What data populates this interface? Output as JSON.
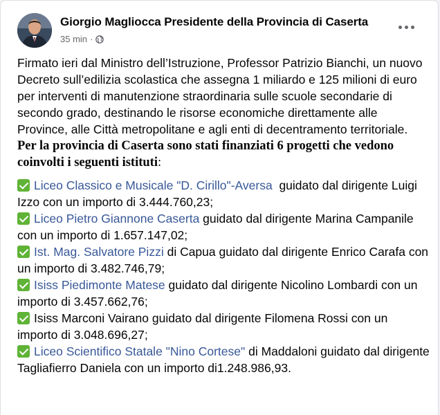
{
  "post": {
    "author": "Giorgio Magliocca Presidente della Provincia di Caserta",
    "time": "35 min",
    "separator": "·",
    "privacy_icon": "globe-icon",
    "more_icon": "more-options-icon",
    "intro": "Firmato ieri dal Ministro dell’Istruzione, Professor Patrizio Bianchi, un nuovo Decreto sull’edilizia scolastica che assegna 1 miliardo e 125 milioni di euro per interventi di manutenzione straordinaria sulle scuole secondarie di secondo grado, destinando le risorse economiche direttamente alle Province, alle Città metropolitane e agli enti di decentramento territoriale.",
    "bold_title": "Per la provincia di Caserta sono stati finanziati 6 progetti che vedono coinvolti i seguenti istituti",
    "bold_title_suffix": ":",
    "entries": [
      {
        "link": "Liceo Classico e Musicale \"D. Cirillo\"-Aversa",
        "text": "  guidato dal dirigente Luigi Izzo con un importo di 3.444.760,23;"
      },
      {
        "link": "Liceo Pietro Giannone Caserta",
        "text": " guidato dal dirigente Marina Campanile con un importo di 1.657.147,02;"
      },
      {
        "link": "Ist. Mag. Salvatore Pizzi",
        "text": " di Capua guidato dal dirigente Enrico Carafa con un importo di 3.482.746,79;"
      },
      {
        "link": "Isiss Piedimonte Matese",
        "text": " guidato dal dirigente Nicolino Lombardi con un importo di 3.457.662,76;"
      },
      {
        "link": "",
        "text": "Isiss Marconi Vairano guidato dal dirigente Filomena Rossi con un importo di 3.048.696,27;"
      },
      {
        "link": "Liceo Scientifico Statale \"Nino Cortese\"",
        "text": " di Maddaloni guidato dal dirigente Tagliafierro Daniela con un importo di1.248.986,93."
      }
    ]
  },
  "colors": {
    "link": "#385898",
    "check": "#5fb336",
    "secondary_text": "#65676b"
  }
}
